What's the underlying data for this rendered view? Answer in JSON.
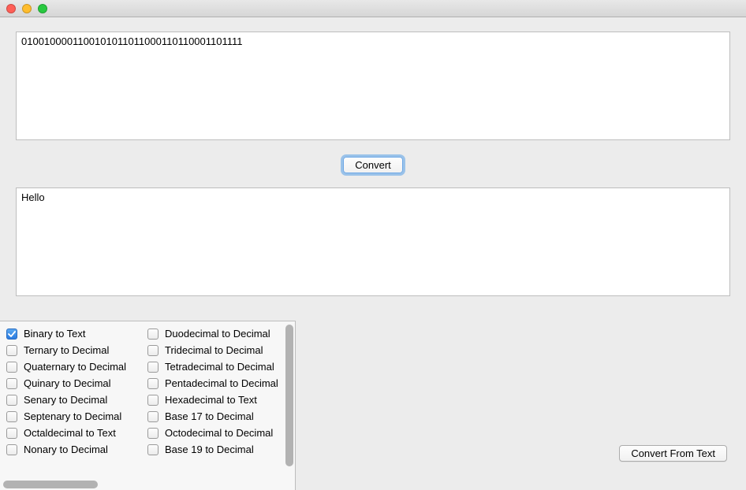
{
  "input_text": "0100100001100101011011000110110001101111",
  "output_text": "Hello",
  "buttons": {
    "convert": "Convert",
    "convert_from_text": "Convert From Text"
  },
  "options": {
    "col1": [
      {
        "label": "Binary to Text",
        "checked": true
      },
      {
        "label": "Ternary to Decimal",
        "checked": false
      },
      {
        "label": "Quaternary to Decimal",
        "checked": false
      },
      {
        "label": "Quinary to Decimal",
        "checked": false
      },
      {
        "label": "Senary to Decimal",
        "checked": false
      },
      {
        "label": "Septenary to Decimal",
        "checked": false
      },
      {
        "label": "Octaldecimal to Text",
        "checked": false
      },
      {
        "label": "Nonary to Decimal",
        "checked": false
      }
    ],
    "col2": [
      {
        "label": "Duodecimal to Decimal",
        "checked": false
      },
      {
        "label": "Tridecimal to Decimal",
        "checked": false
      },
      {
        "label": "Tetradecimal to Decimal",
        "checked": false
      },
      {
        "label": "Pentadecimal to Decimal",
        "checked": false
      },
      {
        "label": "Hexadecimal to Text",
        "checked": false
      },
      {
        "label": "Base 17 to Decimal",
        "checked": false
      },
      {
        "label": "Octodecimal to Decimal",
        "checked": false
      },
      {
        "label": "Base 19 to Decimal",
        "checked": false
      }
    ]
  }
}
